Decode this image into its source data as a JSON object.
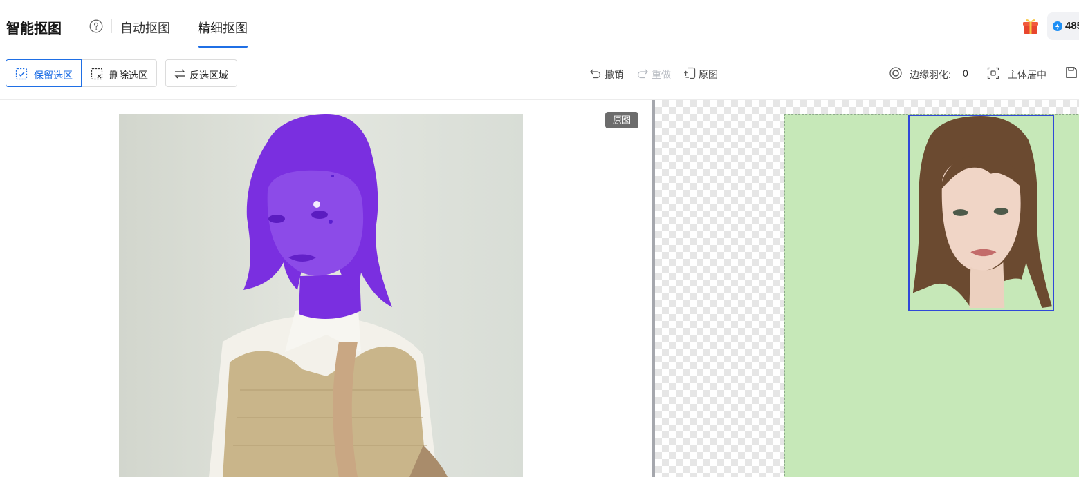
{
  "header": {
    "app_title": "智能抠图",
    "tabs": [
      {
        "label": "自动抠图",
        "active": false
      },
      {
        "label": "精细抠图",
        "active": true
      }
    ],
    "credits": "485"
  },
  "toolbar": {
    "keep_selection": "保留选区",
    "delete_selection": "删除选区",
    "invert_selection": "反选区域",
    "undo": "撤销",
    "redo": "重做",
    "original": "原图",
    "edge_feather_label": "边缘羽化:",
    "edge_feather_value": "0",
    "center_subject": "主体居中"
  },
  "canvas": {
    "original_badge": "原图"
  },
  "colors": {
    "accent": "#1f6fe5",
    "selection_overlay": "#7a2fe0",
    "result_background": "#c6e8b8",
    "subject_frame": "#3048d8"
  }
}
